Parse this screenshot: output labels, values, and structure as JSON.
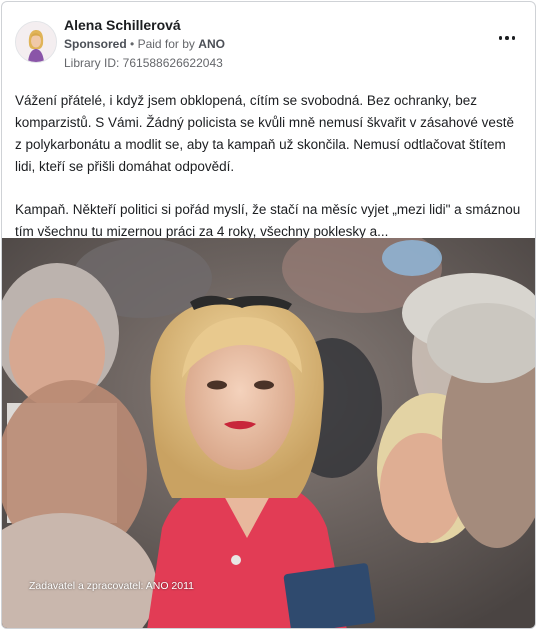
{
  "ad": {
    "page_name": "Alena Schillerová",
    "sponsored_label": "Sponsored",
    "separator": "•",
    "paid_for_prefix": "Paid for by",
    "paid_for_by": "ANO",
    "library_id": "Library ID: 761588626622043",
    "more_options_icon": "more-horizontal-icon",
    "avatar_icon": "profile-photo-icon"
  },
  "body": {
    "paragraph_1": "Vážení přátelé, i když jsem obklopená, cítím se svobodná. Bez ochranky, bez komparzistů. S Vámi. Žádný policista se kvůli mně nemusí škvařit v zásahové vestě z polykarbonátu a modlit se, aby ta kampaň už skončila. Nemusí odtlačovat štítem lidi, kteří se přišli domáhat odpovědí.",
    "paragraph_2": "Kampaň. Někteří politici si pořád myslí, že stačí na měsíc vyjet „mezi lidi\" a smáznou tím všechnu tu mizernou práci za 4 roky, všechny poklesky a..."
  },
  "media": {
    "caption": "Zadavatel a zpracovatel: ANO 2011"
  },
  "colors": {
    "text_primary": "#1c1e21",
    "text_secondary": "#65676b",
    "border": "#cfd2d6",
    "dress": "#e23c55"
  }
}
